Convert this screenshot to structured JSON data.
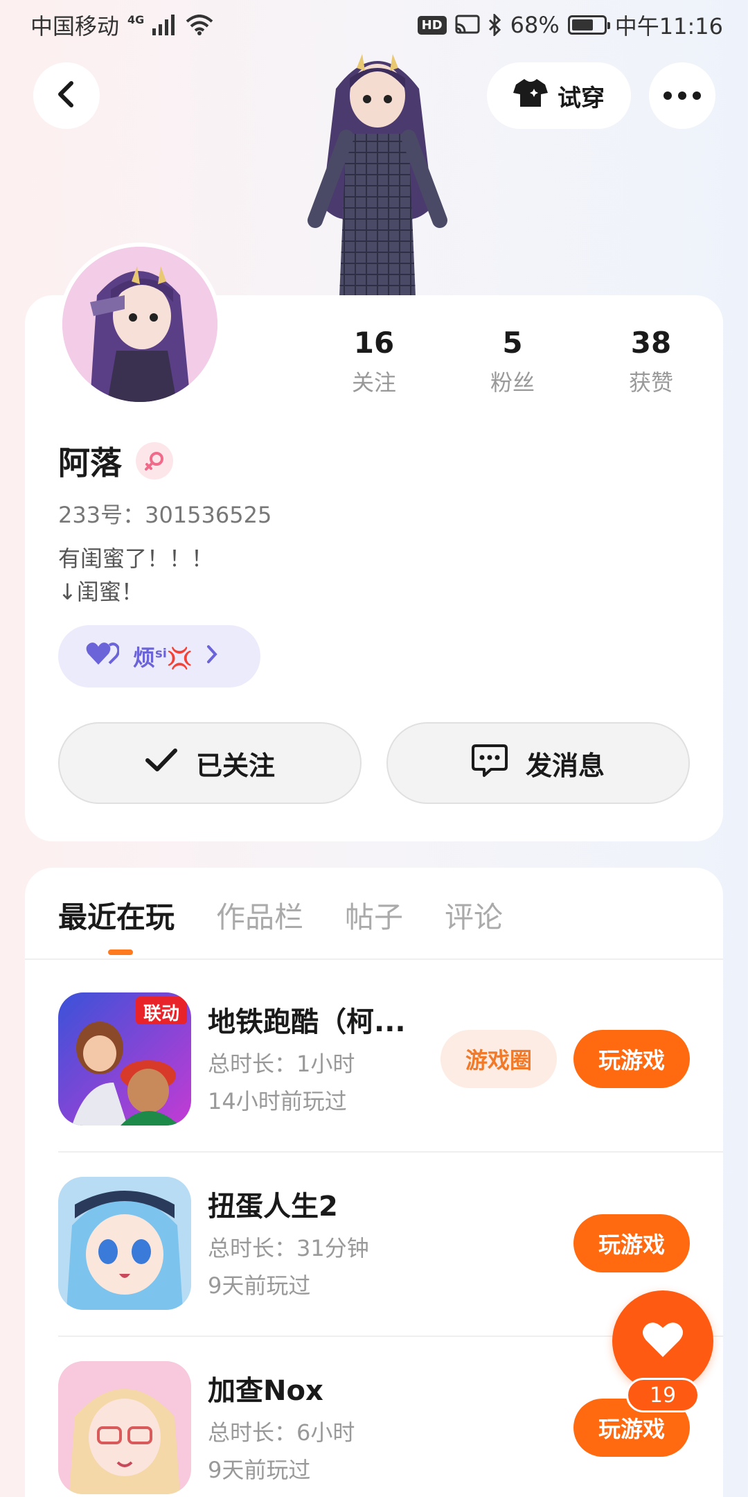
{
  "status_bar": {
    "carrier": "中国移动",
    "network": "4G",
    "battery_percent": "68%",
    "battery_level": 0.68,
    "time": "中午11:16",
    "hd_label": "HD"
  },
  "header": {
    "tryon_label": "试穿"
  },
  "profile": {
    "stats": [
      {
        "value": "16",
        "label": "关注"
      },
      {
        "value": "5",
        "label": "粉丝"
      },
      {
        "value": "38",
        "label": "获赞"
      }
    ],
    "name": "阿落",
    "id_line": "233号：301536525",
    "bio": "有闺蜜了！！！\n↓闺蜜！",
    "bestie_name": "烦",
    "bestie_sup": "si",
    "bestie_emoji": "💢",
    "followed_label": "已关注",
    "message_label": "发消息"
  },
  "tabs": [
    {
      "label": "最近在玩",
      "active": true
    },
    {
      "label": "作品栏",
      "active": false
    },
    {
      "label": "帖子",
      "active": false
    },
    {
      "label": "评论",
      "active": false
    }
  ],
  "games": [
    {
      "title": "地铁跑酷（柯...",
      "duration": "总时长：1小时",
      "last_played": "14小时前玩过",
      "circle_label": "游戏圈",
      "play_label": "玩游戏",
      "icon_badge": "联动"
    },
    {
      "title": "扭蛋人生2",
      "duration": "总时长：31分钟",
      "last_played": "9天前玩过",
      "play_label": "玩游戏"
    },
    {
      "title": "加查Nox",
      "duration": "总时长：6小时",
      "last_played": "9天前玩过",
      "play_label": "玩游戏"
    }
  ],
  "like_count": "19",
  "colors": {
    "accent": "#ff6a10",
    "bestie_purple": "#6b63d8",
    "gender_pink": "#f06a8a"
  }
}
